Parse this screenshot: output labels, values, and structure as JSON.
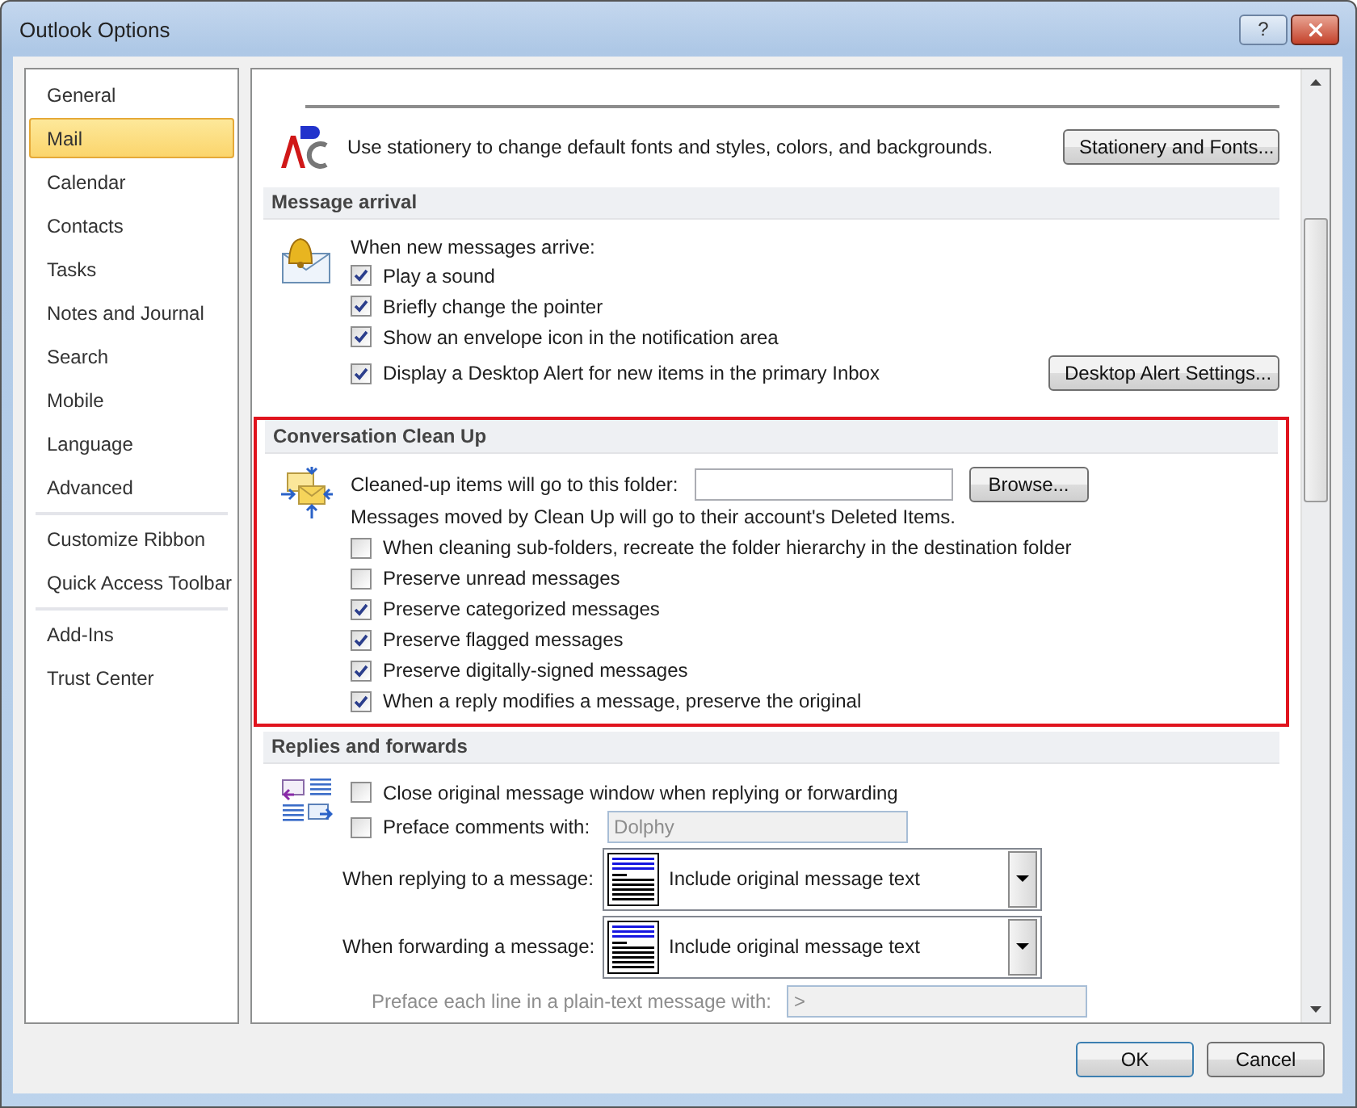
{
  "window": {
    "title": "Outlook Options",
    "help_button": "?"
  },
  "sidebar": {
    "groups": [
      [
        {
          "label": "General",
          "selected": false
        },
        {
          "label": "Mail",
          "selected": true
        },
        {
          "label": "Calendar",
          "selected": false
        },
        {
          "label": "Contacts",
          "selected": false
        },
        {
          "label": "Tasks",
          "selected": false
        },
        {
          "label": "Notes and Journal",
          "selected": false
        },
        {
          "label": "Search",
          "selected": false
        },
        {
          "label": "Mobile",
          "selected": false
        },
        {
          "label": "Language",
          "selected": false
        },
        {
          "label": "Advanced",
          "selected": false
        }
      ],
      [
        {
          "label": "Customize Ribbon",
          "selected": false
        },
        {
          "label": "Quick Access Toolbar",
          "selected": false
        }
      ],
      [
        {
          "label": "Add-Ins",
          "selected": false
        },
        {
          "label": "Trust Center",
          "selected": false
        }
      ]
    ]
  },
  "stationery": {
    "text": "Use stationery to change default fonts and styles, colors, and backgrounds.",
    "button": "Stationery and Fonts..."
  },
  "message_arrival": {
    "title": "Message arrival",
    "intro": "When new messages arrive:",
    "button": "Desktop Alert Settings...",
    "options": [
      {
        "label": "Play a sound",
        "checked": true
      },
      {
        "label": "Briefly change the pointer",
        "checked": true
      },
      {
        "label": "Show an envelope icon in the notification area",
        "checked": true
      },
      {
        "label": "Display a Desktop Alert for new items in the primary Inbox",
        "checked": true
      }
    ]
  },
  "conversation_clean_up": {
    "title": "Conversation Clean Up",
    "highlighted": true,
    "folder_label": "Cleaned-up items will go to this folder:",
    "button": "Browse...",
    "note": "Messages moved by Clean Up will go to their account's Deleted Items.",
    "options": [
      {
        "label": "When cleaning sub-folders, recreate the folder hierarchy in the destination folder",
        "checked": false
      },
      {
        "label": "Preserve unread messages",
        "checked": false
      },
      {
        "label": "Preserve categorized messages",
        "checked": true
      },
      {
        "label": "Preserve flagged messages",
        "checked": true
      },
      {
        "label": "Preserve digitally-signed messages",
        "checked": true
      },
      {
        "label": "When a reply modifies a message, preserve the original",
        "checked": true
      }
    ]
  },
  "replies_and_forwards": {
    "title": "Replies and forwards",
    "close_option": {
      "label": "Close original message window when replying or forwarding",
      "checked": false
    },
    "preface_option": {
      "label": "Preface comments with:",
      "checked": false,
      "value": "Dolphy",
      "disabled": true
    },
    "dropdowns": [
      {
        "label": "When replying to a message:",
        "value": "Include original message text"
      },
      {
        "label": "When forwarding a message:",
        "value": "Include original message text"
      }
    ],
    "plain_text_prefix": {
      "label": "Preface each line in a plain-text message with:",
      "value": ">",
      "disabled": true
    }
  },
  "footer": {
    "buttons": [
      "OK",
      "Cancel"
    ]
  }
}
